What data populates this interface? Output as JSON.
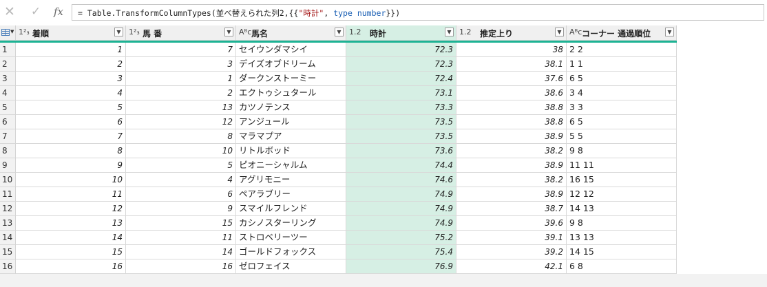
{
  "formula_bar": {
    "cancel_icon": "close-icon",
    "confirm_icon": "check-icon",
    "fx_label": "fx",
    "formula_parts": [
      {
        "text": "= Table.TransformColumnTypes(並べ替えられた列2,{{",
        "kind": "plain"
      },
      {
        "text": "\"時計\"",
        "kind": "str"
      },
      {
        "text": ", ",
        "kind": "plain"
      },
      {
        "text": "type number",
        "kind": "kw"
      },
      {
        "text": "}})",
        "kind": "plain"
      }
    ]
  },
  "colors": {
    "accent": "#1db394",
    "selected_column": "#d6efe4",
    "header_bg": "#f0f0f0"
  },
  "columns": [
    {
      "type_label": "1²₃",
      "name": "着順",
      "selected": false
    },
    {
      "type_label": "1²₃",
      "name": "馬 番",
      "selected": false
    },
    {
      "type_label": "Aᴮc",
      "name": "馬名",
      "selected": false
    },
    {
      "type_label": "1.2",
      "name": "時計",
      "selected": true
    },
    {
      "type_label": "1.2",
      "name": "推定上り",
      "selected": false
    },
    {
      "type_label": "Aᴮc",
      "name": "コーナー 通過順位",
      "selected": false
    }
  ],
  "rows": [
    {
      "n": "1",
      "c": [
        "1",
        "7",
        "セイウンダマシイ",
        "72.3",
        "38",
        "2 2"
      ]
    },
    {
      "n": "2",
      "c": [
        "2",
        "3",
        "デイズオブドリーム",
        "72.3",
        "38.1",
        "1 1"
      ]
    },
    {
      "n": "3",
      "c": [
        "3",
        "1",
        "ダークンストーミー",
        "72.4",
        "37.6",
        "6 5"
      ]
    },
    {
      "n": "4",
      "c": [
        "4",
        "2",
        "エクトゥシュタール",
        "73.1",
        "38.6",
        "3 4"
      ]
    },
    {
      "n": "5",
      "c": [
        "5",
        "13",
        "カツノテンス",
        "73.3",
        "38.8",
        "3 3"
      ]
    },
    {
      "n": "6",
      "c": [
        "6",
        "12",
        "アンジュール",
        "73.5",
        "38.8",
        "6 5"
      ]
    },
    {
      "n": "7",
      "c": [
        "7",
        "8",
        "マラマプア",
        "73.5",
        "38.9",
        "5 5"
      ]
    },
    {
      "n": "8",
      "c": [
        "8",
        "10",
        "リトルボッド",
        "73.6",
        "38.2",
        "9 8"
      ]
    },
    {
      "n": "9",
      "c": [
        "9",
        "5",
        "ピオニーシャルム",
        "74.4",
        "38.9",
        "11 11"
      ]
    },
    {
      "n": "10",
      "c": [
        "10",
        "4",
        "アグリモニー",
        "74.6",
        "38.2",
        "16 15"
      ]
    },
    {
      "n": "11",
      "c": [
        "11",
        "6",
        "ペアラブリー",
        "74.9",
        "38.9",
        "12 12"
      ]
    },
    {
      "n": "12",
      "c": [
        "12",
        "9",
        "スマイルフレンド",
        "74.9",
        "38.7",
        "14 13"
      ]
    },
    {
      "n": "13",
      "c": [
        "13",
        "15",
        "カシノスターリング",
        "74.9",
        "39.6",
        "9 8"
      ]
    },
    {
      "n": "14",
      "c": [
        "14",
        "11",
        "ストロベリーツー",
        "75.2",
        "39.1",
        "13 13"
      ]
    },
    {
      "n": "15",
      "c": [
        "15",
        "14",
        "ゴールドフォックス",
        "75.4",
        "39.2",
        "14 15"
      ]
    },
    {
      "n": "16",
      "c": [
        "16",
        "16",
        "ゼロフェイス",
        "76.9",
        "42.1",
        "6 8"
      ]
    }
  ]
}
